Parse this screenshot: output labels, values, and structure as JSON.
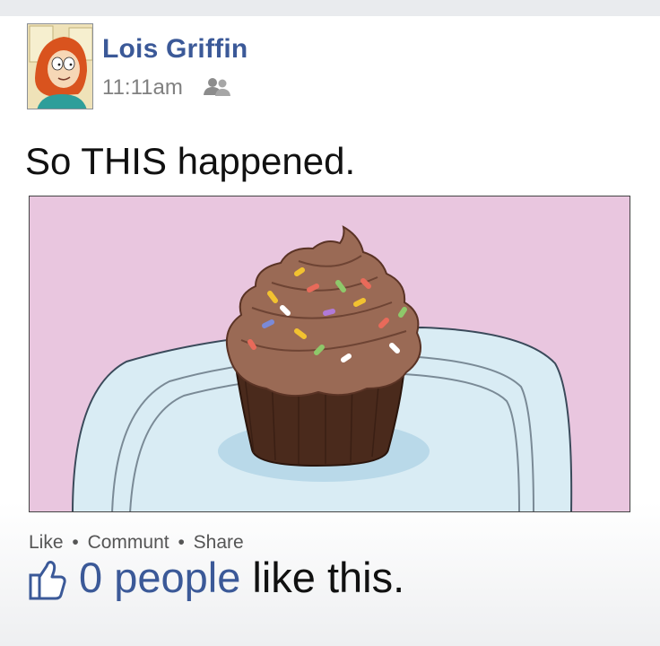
{
  "post": {
    "author": "Lois Griffin",
    "time": "11:11am",
    "text": "So THIS happened.",
    "audience_icon": "friends-icon"
  },
  "photo": {
    "subject": "chocolate-cupcake-with-sprinkles",
    "colors": {
      "background": "#e9c6df",
      "plate": "#d9ecf4",
      "frosting": "#9a6a55",
      "liner": "#4a2a1c"
    }
  },
  "actions": {
    "like": "Like",
    "comment": "Communt",
    "share": "Share",
    "separator": "•"
  },
  "likes": {
    "icon": "thumbs-up-icon",
    "count_text": "0 people",
    "suffix": " like this."
  },
  "colors": {
    "link": "#3b5998",
    "text": "#111111",
    "meta": "#808080"
  }
}
